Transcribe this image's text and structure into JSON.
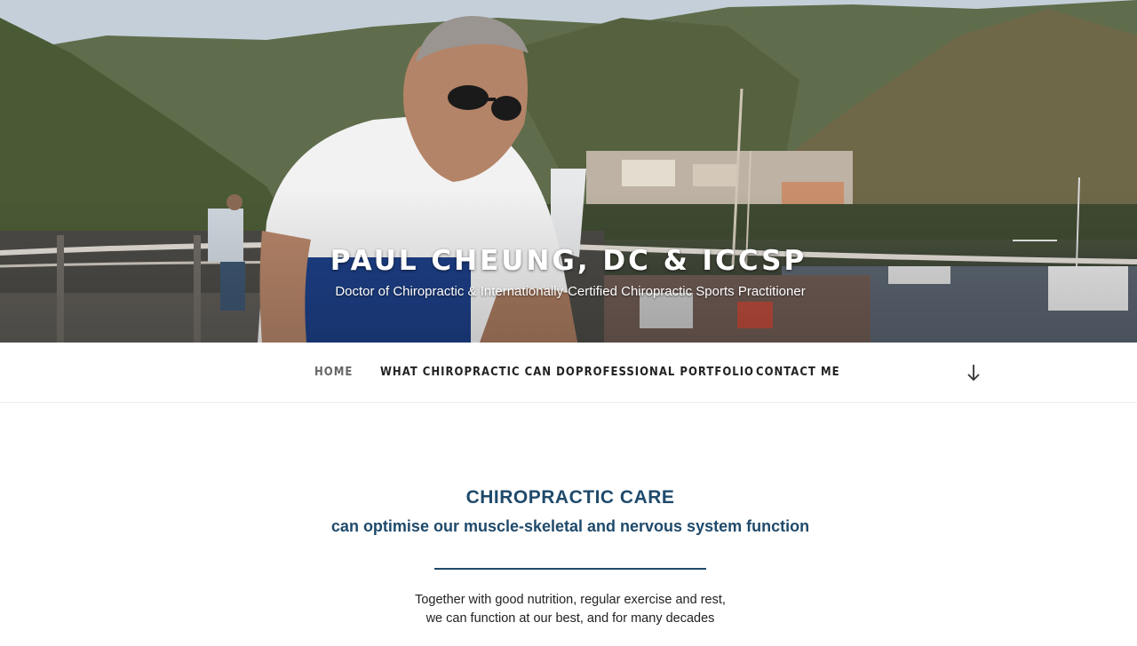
{
  "header": {
    "site_title": "PAUL CHEUNG, DC & ICCSP",
    "site_description": "Doctor of Chiropractic & Internationally-Certified Chiropractic Sports Practitioner"
  },
  "nav": {
    "items": [
      {
        "label": "HOME",
        "active": true
      },
      {
        "label": "WHAT CHIROPRACTIC CAN DO",
        "active": false
      },
      {
        "label": "PROFESSIONAL PORTFOLIO",
        "active": false
      },
      {
        "label": "CONTACT ME",
        "active": false
      }
    ],
    "scroll_icon": "arrow-down-icon"
  },
  "main": {
    "heading": "CHIROPRACTIC CARE",
    "subheading": "can optimise our muscle-skeletal and nervous system function",
    "body_lines": [
      "Together with good nutrition, regular exercise and rest,",
      "we can function at our best, and for many decades"
    ]
  },
  "colors": {
    "accent": "#1f4a6b",
    "nav_text": "#222222",
    "nav_active": "#666666"
  }
}
